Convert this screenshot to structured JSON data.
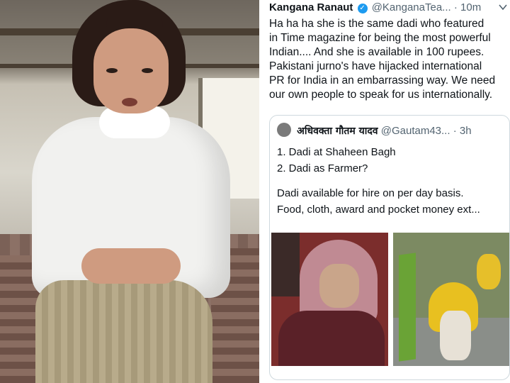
{
  "tweet": {
    "name": "Kangana Ranaut",
    "verified_icon": "✓",
    "handle": "@KanganaTea...",
    "time": "· 10m",
    "menu_icon": "chevron-down-icon",
    "body_lines": [
      "Ha ha ha she is the same dadi who featured",
      "in Time magazine for being the most powerful",
      "Indian.... And she is available in 100 rupees.",
      "Pakistani jurno's have hijacked international",
      "PR for India in an embarrassing way. We need",
      "our own people to speak for us internationally."
    ]
  },
  "quote": {
    "name": "अधिवक्ता गौतम यादव",
    "handle": "@Gautam43...",
    "time": "· 3h",
    "lines_a": [
      "1. Dadi at Shaheen Bagh",
      "2. Dadi as Farmer?"
    ],
    "lines_b": [
      "Dadi available for hire on per day basis.",
      "Food, cloth, award and pocket money ext..."
    ]
  },
  "colors": {
    "verified": "#1d9bf0",
    "muted_text": "#536471",
    "border": "#cfd9de"
  }
}
